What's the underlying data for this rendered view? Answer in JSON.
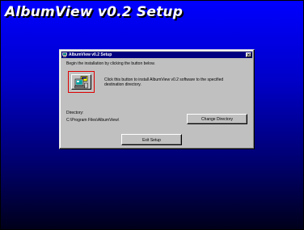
{
  "installer": {
    "title": "AlbumView v0.2 Setup"
  },
  "dialog": {
    "title": "AlbumView v0.2 Setup",
    "close_glyph": "×",
    "instruction": "Begin the installation by clicking the button below.",
    "install_description_line1": "Click this button to install AlbumView v0.2 software to the specified",
    "install_description_line2": "destination directory.",
    "directory_label": "Directory:",
    "directory_value": "C:\\Program Files\\AlbumView\\",
    "change_directory_label": "Change Directory",
    "exit_setup_label": "Exit Setup",
    "install_button_icon": "computer-install-icon",
    "highlight_color": "#e00000"
  }
}
